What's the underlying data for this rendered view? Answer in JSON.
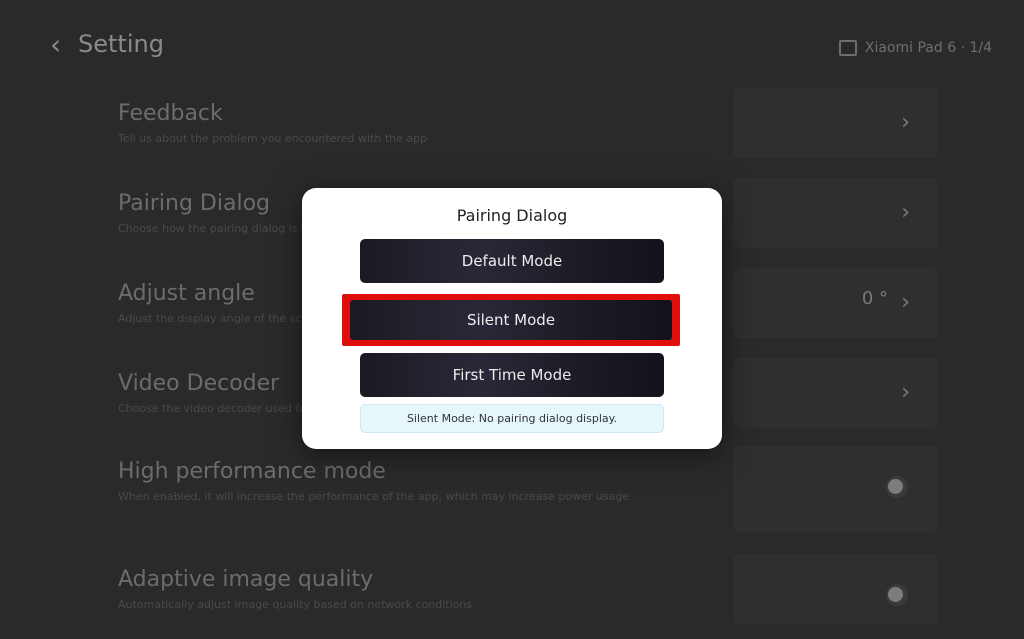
{
  "header": {
    "back_icon": "chevron-left-icon",
    "title": "Setting",
    "device_name": "Xiaomi Pad 6 · 1/4",
    "device_icon": "monitor-icon"
  },
  "settings": [
    {
      "title": "Feedback",
      "subtitle": "Tell us about the problem you encountered with the app",
      "control": "chevron"
    },
    {
      "title": "Pairing Dialog",
      "subtitle": "Choose how the pairing dialog is displayed",
      "control": "chevron"
    },
    {
      "title": "Adjust angle",
      "subtitle": "Adjust the display angle of the screen",
      "control": "value",
      "value": "0 °"
    },
    {
      "title": "Video Decoder",
      "subtitle": "Choose the video decoder used for mirroring",
      "control": "chevron"
    },
    {
      "title": "High performance mode",
      "subtitle": "When enabled, it will increase the performance of the app, which may increase power usage",
      "control": "toggle",
      "enabled": false
    },
    {
      "title": "Adaptive image quality",
      "subtitle": "Automatically adjust image quality based on network conditions",
      "control": "toggle",
      "enabled": false
    }
  ],
  "dialog": {
    "title": "Pairing Dialog",
    "options": [
      {
        "label": "Default Mode",
        "selected": false
      },
      {
        "label": "Silent Mode",
        "selected": true
      },
      {
        "label": "First Time Mode",
        "selected": false
      }
    ],
    "hint": "Silent Mode: No pairing dialog display."
  },
  "colors": {
    "highlight": "#e00d0d",
    "hint_bg": "#e6f7fb",
    "background": "#2a2a2c"
  }
}
